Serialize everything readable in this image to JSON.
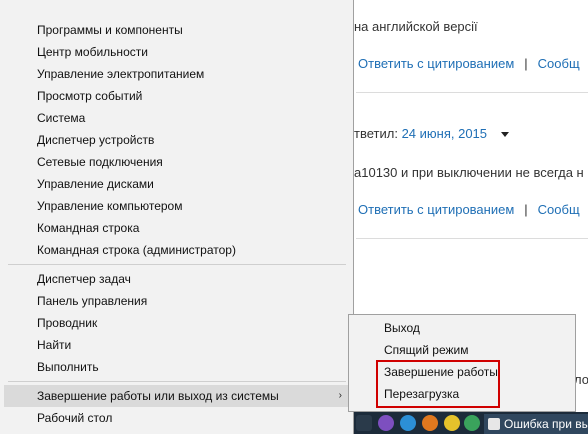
{
  "background_page": {
    "line1": "на английской версії",
    "reply_quote_link": "Ответить с цитированием",
    "separator": "|",
    "message_link": "Сообщ",
    "replied_prefix": "тветил:",
    "replied_date": "24 июня, 2015",
    "body_text": "а10130 и при выключении не всегда н",
    "reply_quote_link_2": "Ответить с цитированием",
    "message_link_2": "Сообщ",
    "edge_text": "ло"
  },
  "context_menu": {
    "items_group1": [
      "Программы и компоненты",
      "Центр мобильности",
      "Управление электропитанием",
      "Просмотр событий",
      "Система",
      "Диспетчер устройств",
      "Сетевые подключения",
      "Управление дисками",
      "Управление компьютером",
      "Командная строка",
      "Командная строка (администратор)"
    ],
    "items_group2": [
      "Диспетчер задач",
      "Панель управления",
      "Проводник",
      "Найти",
      "Выполнить"
    ],
    "shutdown_item": "Завершение работы или выход из системы",
    "shutdown_arrow": "›",
    "desktop_item": "Рабочий стол"
  },
  "submenu": {
    "items": [
      "Выход",
      "Спящий режим",
      "Завершение работы",
      "Перезагрузка"
    ]
  },
  "taskbar": {
    "window_label": "Ошибка при выкл",
    "icons": [
      "viber-icon",
      "skype-icon",
      "media-player-icon",
      "yandex-browser-icon",
      "chrome-icon",
      "notes-icon"
    ]
  },
  "colors": {
    "highlight_box": "#d00000",
    "link": "#1f6fb5",
    "menu_bg": "#f2f2f2",
    "menu_hover": "#dadada",
    "taskbar": "#1c2b3a"
  }
}
